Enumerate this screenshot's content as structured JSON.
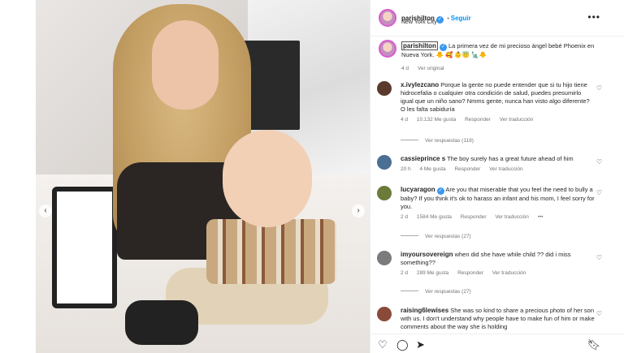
{
  "post": {
    "username": "parishilton",
    "follow_label": "Seguir",
    "location": "New York City",
    "more_icon": "more-horizontal-icon",
    "caption_user": "parishilton",
    "caption_text": "La primera vez de mi precioso ángel bebé Phoenix en Nueva York. 🐥 🥰 👶😇 🗽🐥",
    "caption_age": "4 d",
    "caption_translate": "Ver original",
    "accent": "#0095f6",
    "verified_color": "#3897f0"
  },
  "comments": [
    {
      "user": "x.ivylezcano",
      "text": "Porque la gente no puede entender que si tu hijo tiene hidrocefalia o cualquier otra condición de salud, puedes presumirlo igual que un niño sano? Nmms gente, nunca han visto algo diferente? O les falta sabiduría",
      "age": "4 d",
      "likes": "10.132 Me gusta",
      "reply": "Responder",
      "translate": "Ver traducción",
      "replies": "Ver respuestas (119)",
      "avatar_color": "#5b3a2e",
      "verified": false
    },
    {
      "user": "cassieprince s",
      "text": "The boy surely has a great future ahead of him",
      "age": "20 h",
      "likes": "4 Me gusta",
      "reply": "Responder",
      "translate": "Ver traducción",
      "replies": "",
      "avatar_color": "#4a6f93",
      "verified": false
    },
    {
      "user": "lucyaragon",
      "text": "Are you that miserable that you feel the need to bully a baby? If you think it's ok to harass an infant and his mom, I feel sorry for you.",
      "age": "2 d",
      "likes": "1584 Me gusta",
      "reply": "Responder",
      "translate": "Ver traducción",
      "extra": "•••",
      "replies": "Ver respuestas (27)",
      "avatar_color": "#6b7b3a",
      "verified": true
    },
    {
      "user": "imyoursovereign",
      "text": "when did she have while child ?? did i miss something??",
      "age": "2 d",
      "likes": "289 Me gusta",
      "reply": "Responder",
      "translate": "Ver traducción",
      "replies": "Ver respuestas (27)",
      "avatar_color": "#7b7b7b",
      "verified": false
    },
    {
      "user": "raising6lewises",
      "text": "She was so kind to share a precious photo of her son with us. I don't understand why people have to make fun of him or make comments about the way she is holding",
      "age": "",
      "likes": "",
      "reply": "",
      "translate": "",
      "replies": "",
      "avatar_color": "#8a4a3a",
      "verified": false
    }
  ],
  "actions": {
    "like_icon": "heart-outline-icon",
    "comment_icon": "comment-icon",
    "share_icon": "send-icon",
    "save_icon": "bookmark-icon"
  },
  "photo_nav": {
    "prev_icon": "chevron-left-icon",
    "next_icon": "chevron-right-icon"
  }
}
